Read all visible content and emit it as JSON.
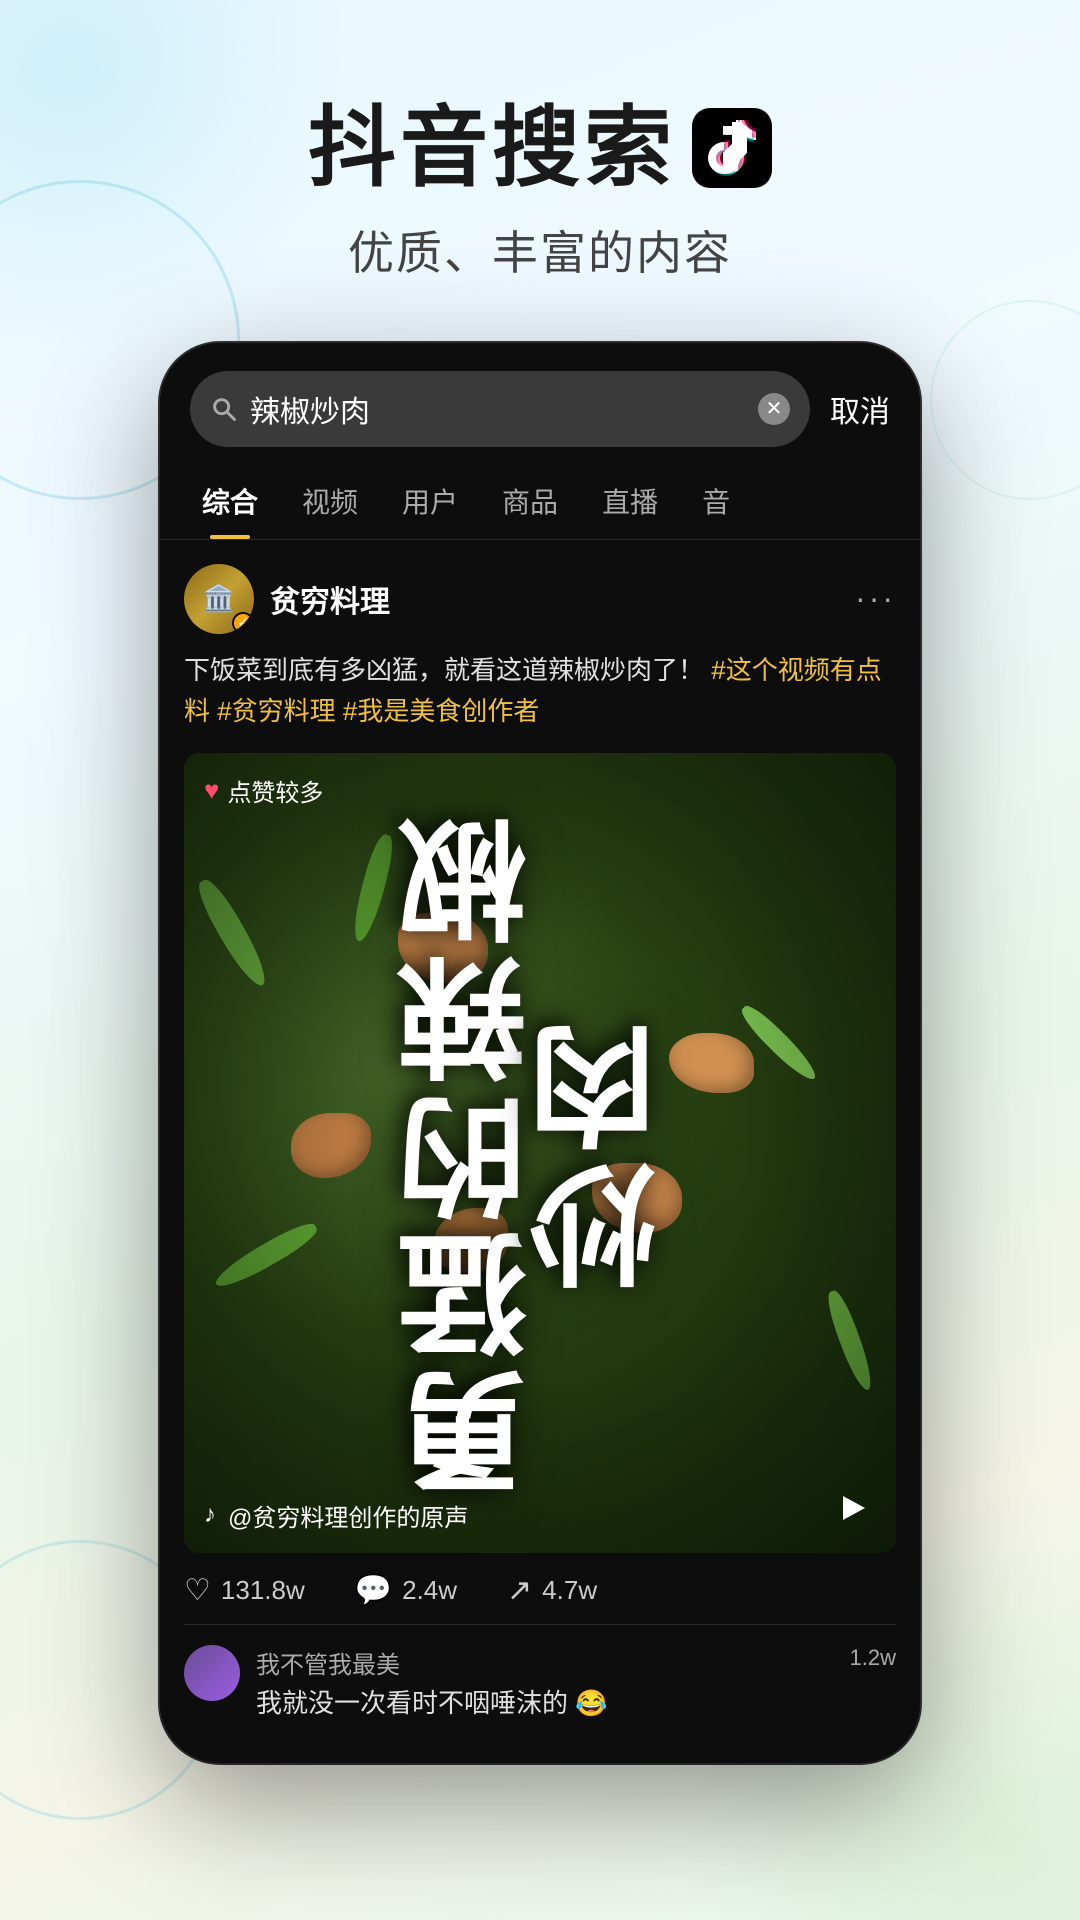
{
  "header": {
    "title": "抖音搜索",
    "logo_label": "tiktok-logo",
    "subtitle": "优质、丰富的内容"
  },
  "phone": {
    "search_bar": {
      "query": "辣椒炒肉",
      "placeholder": "搜索",
      "cancel_label": "取消"
    },
    "tabs": [
      {
        "label": "综合",
        "active": true
      },
      {
        "label": "视频",
        "active": false
      },
      {
        "label": "用户",
        "active": false
      },
      {
        "label": "商品",
        "active": false
      },
      {
        "label": "直播",
        "active": false
      },
      {
        "label": "音",
        "active": false
      }
    ],
    "post": {
      "username": "贫穷料理",
      "description": "下饭菜到底有多凶猛，就看这道辣椒炒肉了！",
      "hashtags": [
        "#这个视频有点料",
        "#贫穷料理",
        "#我是美食创作者"
      ],
      "video_text": "勇猛的辣椒炒肉",
      "video_badge": "点赞较多",
      "audio_text": "@贫穷料理创作的原声",
      "engagement": {
        "likes": "131.8w",
        "comments": "2.4w",
        "shares": "4.7w"
      }
    },
    "comments": [
      {
        "username": "我不管我最美",
        "text": "我就没一次看时不咽唾沫的 😂",
        "likes": "1.2w"
      }
    ]
  }
}
